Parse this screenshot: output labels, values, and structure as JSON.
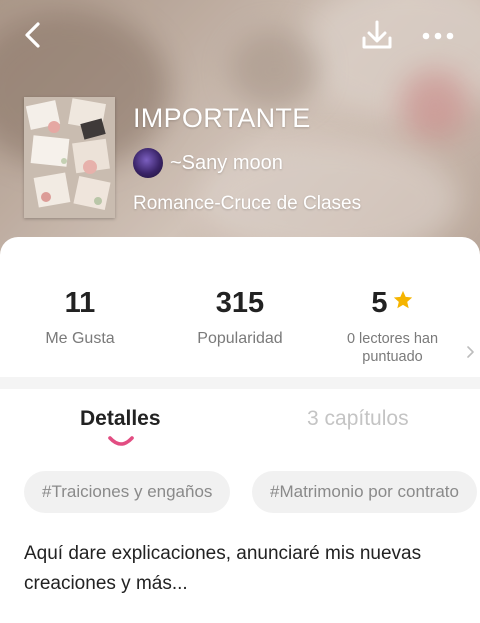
{
  "story": {
    "title": "IMPORTANTE",
    "author": "~Sany moon",
    "genre": "Romance-Cruce de Clases"
  },
  "stats": {
    "likes": {
      "value": "11",
      "label": "Me Gusta"
    },
    "popularity": {
      "value": "315",
      "label": "Popularidad"
    },
    "rating": {
      "value": "5",
      "label": "0 lectores han puntuado",
      "star_color": "#f5b400"
    }
  },
  "tabs": {
    "details": "Detalles",
    "chapters": "3 capítulos",
    "active_indicator_color": "#e24d82"
  },
  "tags": [
    "#Traiciones y engaños",
    "#Matrimonio por contrato"
  ],
  "description": "Aquí dare explicaciones, anunciaré mis nuevas creaciones y más...",
  "icons": {
    "back": "chevron-left-icon",
    "download": "download-icon",
    "more": "more-dots-icon",
    "rating": "star-icon",
    "rating_more": "chevron-right-icon"
  }
}
